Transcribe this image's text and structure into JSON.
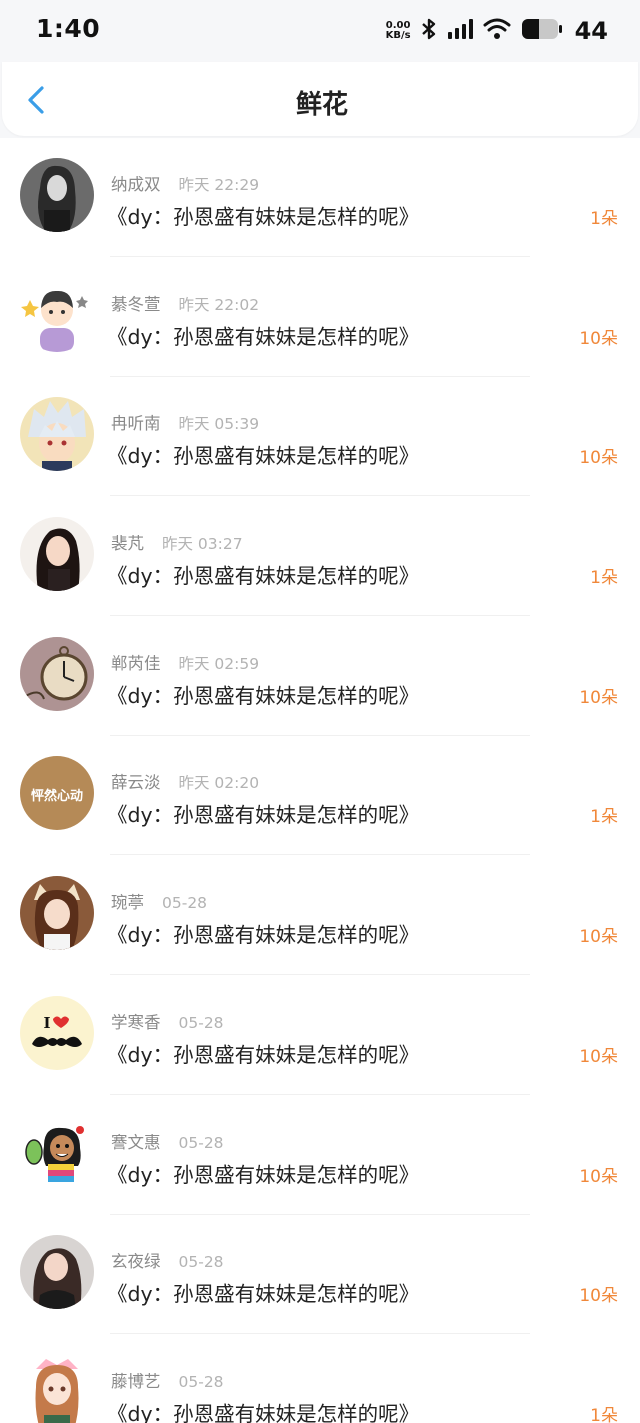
{
  "status_bar": {
    "time": "1:40",
    "net_speed_value": "0.00",
    "net_speed_unit": "KB/s",
    "battery": "44",
    "icons": [
      "bluetooth-icon",
      "signal-icon",
      "wifi-icon",
      "battery-icon"
    ]
  },
  "nav": {
    "title": "鲜花",
    "back_icon": "chevron-left-icon",
    "accent": "#3a9ee8"
  },
  "colors": {
    "amount": "#f0883a",
    "name": "#8a8a8a",
    "time": "#b3b3b3"
  },
  "items": [
    {
      "name": "纳成双",
      "time": "昨天 22:29",
      "title": "《dy：孙恩盛有妹妹是怎样的呢》",
      "amount": "1朵",
      "avatar": "avatar-girl-bw"
    },
    {
      "name": "綦冬萱",
      "time": "昨天 22:02",
      "title": "《dy：孙恩盛有妹妹是怎样的呢》",
      "amount": "10朵",
      "avatar": "avatar-cartoon-boy"
    },
    {
      "name": "冉听南",
      "time": "昨天 05:39",
      "title": "《dy：孙恩盛有妹妹是怎样的呢》",
      "amount": "10朵",
      "avatar": "avatar-anime-white-hair"
    },
    {
      "name": "裴芃",
      "time": "昨天 03:27",
      "title": "《dy：孙恩盛有妹妹是怎样的呢》",
      "amount": "1朵",
      "avatar": "avatar-girl-dark-hair"
    },
    {
      "name": "郸芮佳",
      "time": "昨天 02:59",
      "title": "《dy：孙恩盛有妹妹是怎样的呢》",
      "amount": "10朵",
      "avatar": "avatar-pocket-watch"
    },
    {
      "name": "薛云淡",
      "time": "昨天 02:20",
      "title": "《dy：孙恩盛有妹妹是怎样的呢》",
      "amount": "1朵",
      "avatar": "avatar-text-gold",
      "avatar_text": "怦然心动"
    },
    {
      "name": "琬葶",
      "time": "05-28",
      "title": "《dy：孙恩盛有妹妹是怎样的呢》",
      "amount": "10朵",
      "avatar": "avatar-girl-cat-ears"
    },
    {
      "name": "学寒香",
      "time": "05-28",
      "title": "《dy：孙恩盛有妹妹是怎样的呢》",
      "amount": "10朵",
      "avatar": "avatar-i-love-mustache",
      "avatar_text": "I"
    },
    {
      "name": "謇文惠",
      "time": "05-28",
      "title": "《dy：孙恩盛有妹妹是怎样的呢》",
      "amount": "10朵",
      "avatar": "avatar-cartoon-girl-colorful"
    },
    {
      "name": "玄夜绿",
      "time": "05-28",
      "title": "《dy：孙恩盛有妹妹是怎样的呢》",
      "amount": "10朵",
      "avatar": "avatar-girl-photo"
    },
    {
      "name": "藤博艺",
      "time": "05-28",
      "title": "《dy：孙恩盛有妹妹是怎样的呢》",
      "amount": "1朵",
      "avatar": "avatar-anime-girl"
    }
  ]
}
